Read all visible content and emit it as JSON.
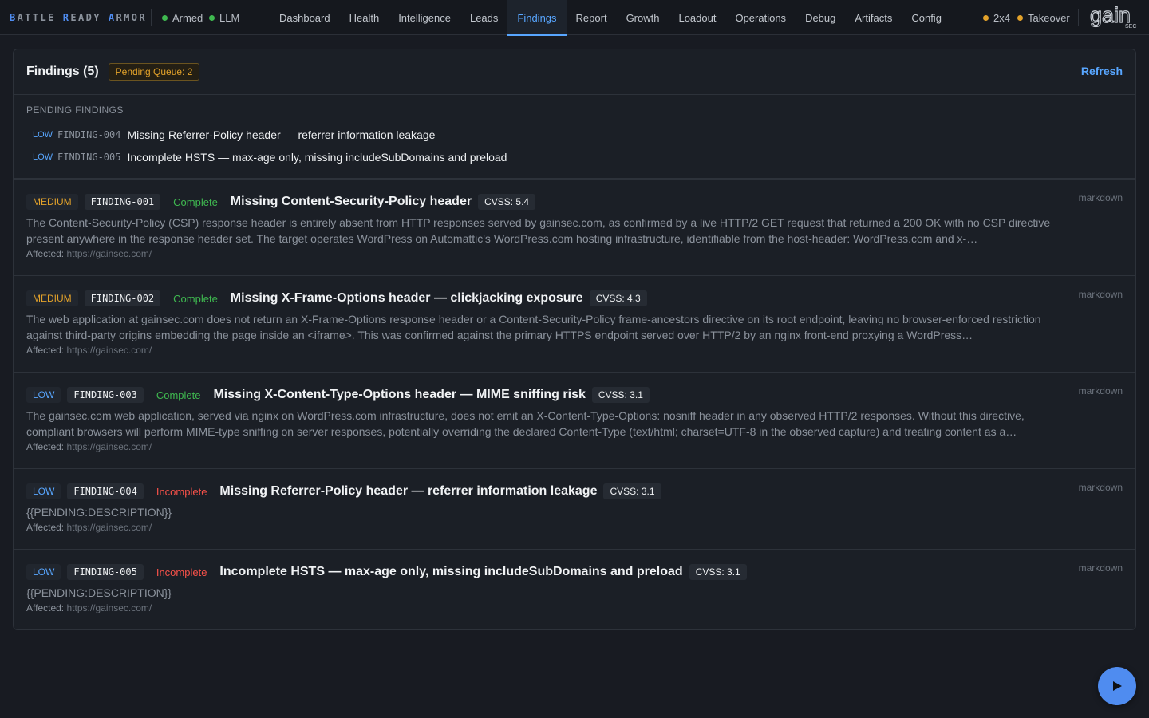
{
  "brand": {
    "words": [
      {
        "cap": "B",
        "rest": "ATTLE"
      },
      {
        "cap": "R",
        "rest": "EADY"
      },
      {
        "cap": "A",
        "rest": "RMOR"
      }
    ]
  },
  "status": {
    "armed": "Armed",
    "llm": "LLM",
    "mode": "2x4",
    "takeover": "Takeover"
  },
  "nav": {
    "items": [
      "Dashboard",
      "Health",
      "Intelligence",
      "Leads",
      "Findings",
      "Report",
      "Growth",
      "Loadout",
      "Operations",
      "Debug",
      "Artifacts",
      "Config"
    ],
    "active": "Findings"
  },
  "logo": {
    "text": "gain",
    "sub": "SEC"
  },
  "colors": {
    "accent": "#58a6ff",
    "medium": "#e3a22a",
    "complete": "#3fb950",
    "incomplete": "#f85149"
  },
  "panel": {
    "title": "Findings (5)",
    "queue_badge": "Pending Queue: 2",
    "refresh": "Refresh"
  },
  "pending": {
    "heading": "PENDING FINDINGS",
    "items": [
      {
        "severity": "LOW",
        "id": "FINDING-004",
        "title": "Missing Referrer-Policy header — referrer information leakage"
      },
      {
        "severity": "LOW",
        "id": "FINDING-005",
        "title": "Incomplete HSTS — max-age only, missing includeSubDomains and preload"
      }
    ]
  },
  "findings": [
    {
      "severity": "MEDIUM",
      "id": "FINDING-001",
      "state": "Complete",
      "title": "Missing Content-Security-Policy header",
      "cvss": "CVSS: 5.4",
      "description": "The Content-Security-Policy (CSP) response header is entirely absent from HTTP responses served by gainsec.com, as confirmed by a live HTTP/2 GET request that returned a 200 OK with no CSP directive present anywhere in the response header set. The target operates WordPress on Automattic's WordPress.com hosting infrastructure, identifiable from the host-header: WordPress.com and x-…",
      "affected_label": "Affected:",
      "affected_url": "https://gainsec.com/",
      "format": "markdown"
    },
    {
      "severity": "MEDIUM",
      "id": "FINDING-002",
      "state": "Complete",
      "title": "Missing X-Frame-Options header — clickjacking exposure",
      "cvss": "CVSS: 4.3",
      "description": "The web application at gainsec.com does not return an X-Frame-Options response header or a Content-Security-Policy frame-ancestors directive on its root endpoint, leaving no browser-enforced restriction against third-party origins embedding the page inside an <iframe>. This was confirmed against the primary HTTPS endpoint served over HTTP/2 by an nginx front-end proxying a WordPress…",
      "affected_label": "Affected:",
      "affected_url": "https://gainsec.com/",
      "format": "markdown"
    },
    {
      "severity": "LOW",
      "id": "FINDING-003",
      "state": "Complete",
      "title": "Missing X-Content-Type-Options header — MIME sniffing risk",
      "cvss": "CVSS: 3.1",
      "description": "The gainsec.com web application, served via nginx on WordPress.com infrastructure, does not emit an X-Content-Type-Options: nosniff header in any observed HTTP/2 responses. Without this directive, compliant browsers will perform MIME-type sniffing on server responses, potentially overriding the declared Content-Type (text/html; charset=UTF-8 in the observed capture) and treating content as a…",
      "affected_label": "Affected:",
      "affected_url": "https://gainsec.com/",
      "format": "markdown"
    },
    {
      "severity": "LOW",
      "id": "FINDING-004",
      "state": "Incomplete",
      "title": "Missing Referrer-Policy header — referrer information leakage",
      "cvss": "CVSS: 3.1",
      "description": "{{PENDING:DESCRIPTION}}",
      "affected_label": "Affected:",
      "affected_url": "https://gainsec.com/",
      "format": "markdown"
    },
    {
      "severity": "LOW",
      "id": "FINDING-005",
      "state": "Incomplete",
      "title": "Incomplete HSTS — max-age only, missing includeSubDomains and preload",
      "cvss": "CVSS: 3.1",
      "description": "{{PENDING:DESCRIPTION}}",
      "affected_label": "Affected:",
      "affected_url": "https://gainsec.com/",
      "format": "markdown"
    }
  ],
  "fab": {
    "icon": "play-icon"
  }
}
